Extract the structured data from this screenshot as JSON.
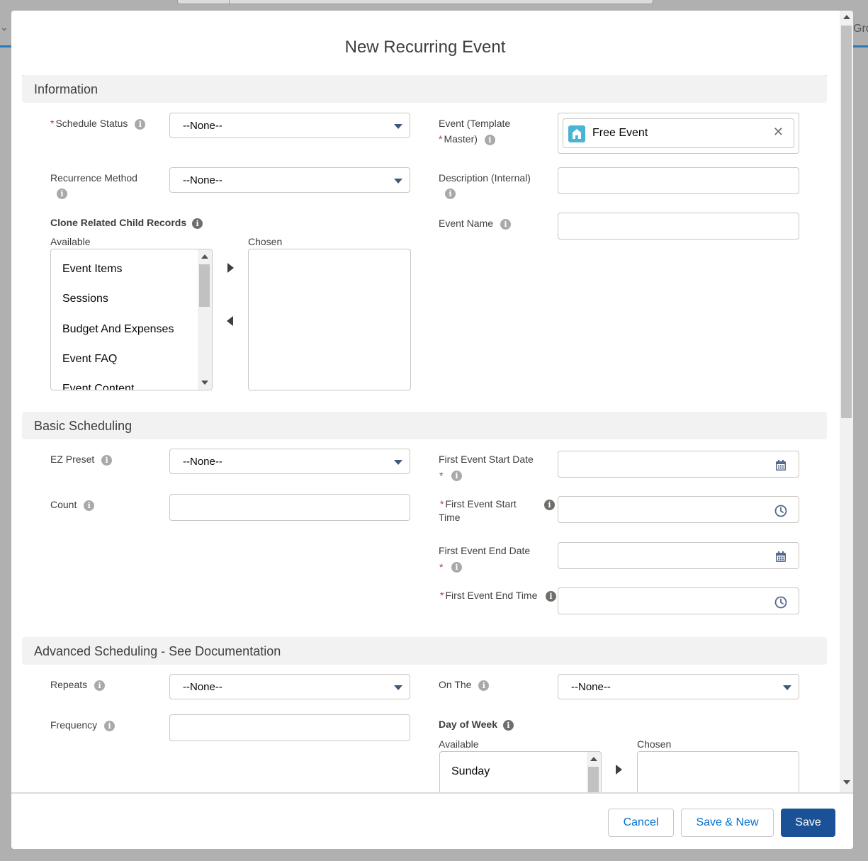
{
  "background": {
    "left_tab_glyph": "⌄",
    "right_tab_text": "Gro"
  },
  "modal": {
    "title": "New Recurring Event"
  },
  "sections": {
    "information": "Information",
    "basic": "Basic Scheduling",
    "advanced": "Advanced Scheduling - See Documentation"
  },
  "info_section": {
    "schedule_status": {
      "label": "Schedule Status",
      "value": "--None--"
    },
    "event_template": {
      "label_line1": "Event (Template",
      "label_line2": "Master)",
      "value": "Free Event",
      "icon": "event-icon"
    },
    "recurrence_method": {
      "label": "Recurrence Method",
      "value": "--None--"
    },
    "description": {
      "label": "Description (Internal)",
      "value": ""
    },
    "event_name": {
      "label": "Event Name",
      "value": ""
    },
    "clone_related": {
      "label": "Clone Related Child Records",
      "available_label": "Available",
      "chosen_label": "Chosen",
      "available": [
        "Event Items",
        "Sessions",
        "Budget And Expenses",
        "Event FAQ",
        "Event Content"
      ]
    }
  },
  "basic_section": {
    "ez_preset": {
      "label": "EZ Preset",
      "value": "--None--"
    },
    "count": {
      "label": "Count",
      "value": ""
    },
    "first_start_date": {
      "label": "First Event Start Date"
    },
    "first_start_time": {
      "label_line1": "First Event Start",
      "label_line2": "Time"
    },
    "first_end_date": {
      "label": "First Event End Date"
    },
    "first_end_time": {
      "label": "First Event End Time"
    }
  },
  "advanced_section": {
    "repeats": {
      "label": "Repeats",
      "value": "--None--"
    },
    "on_the": {
      "label": "On The",
      "value": "--None--"
    },
    "frequency": {
      "label": "Frequency",
      "value": ""
    },
    "day_of_week": {
      "label": "Day of Week",
      "available_label": "Available",
      "chosen_label": "Chosen",
      "available": [
        "Sunday"
      ]
    }
  },
  "footer": {
    "cancel": "Cancel",
    "save_new": "Save & New",
    "save": "Save"
  },
  "colors": {
    "brand": "#1b5297",
    "link": "#0070d2",
    "required": "#c23934",
    "section_bg": "#f3f2f2"
  }
}
